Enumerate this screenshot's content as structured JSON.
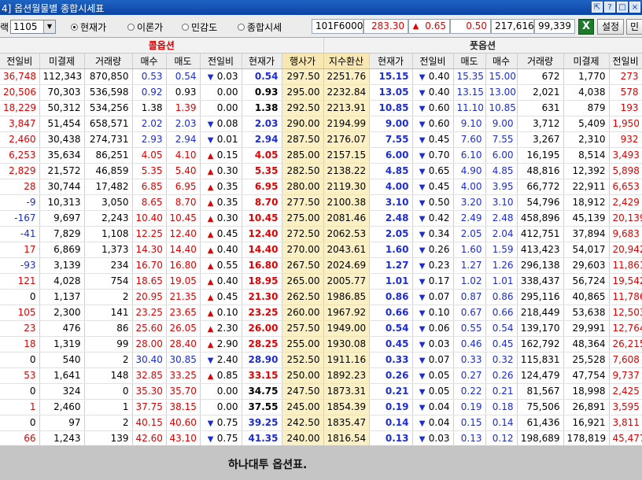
{
  "window": {
    "title": "4] 옵션월물별 종합시세표",
    "buttons": [
      "⇱",
      "?",
      "□",
      "×"
    ]
  },
  "toolbar": {
    "month_label": "랙",
    "month_value": "1105",
    "radios": [
      {
        "label": "현재가",
        "checked": true
      },
      {
        "label": "이론가",
        "checked": false
      },
      {
        "label": "민감도",
        "checked": false
      },
      {
        "label": "종합시세",
        "checked": false
      }
    ],
    "future_code": "101F6000",
    "future_price": "283.30",
    "future_change_sign": "▲",
    "future_change": "0.65",
    "future_change_pct": "0.50",
    "future_volume": "217,616",
    "future_oi": "99,339",
    "excel_icon": "X",
    "settings_label": "설정",
    "extra_label": "민"
  },
  "groups": {
    "call": "콜옵션",
    "put": "풋옵션"
  },
  "headers": [
    "전일비",
    "미결제",
    "거래량",
    "매수",
    "매도",
    "전일비",
    "현재가",
    "행사가",
    "지수환산",
    "현재가",
    "전일비",
    "매도",
    "매수",
    "거래량",
    "미결제",
    "전일비"
  ],
  "rows": [
    {
      "c": [
        "36,748",
        "112,343",
        "870,850",
        "0.53",
        "0.54",
        "down",
        "0.03",
        "0.54",
        "297.50",
        "2251.76",
        "15.15",
        "down",
        "0.40",
        "15.35",
        "15.00",
        "672",
        "1,770",
        "273"
      ],
      "col": [
        "red",
        "black",
        "black",
        "blue",
        "blue",
        "blue",
        "black",
        "blue",
        "black",
        "black",
        "blue",
        "blue",
        "black",
        "blue",
        "blue",
        "black",
        "black",
        "red"
      ]
    },
    {
      "c": [
        "20,506",
        "70,303",
        "536,598",
        "0.92",
        "0.93",
        "flat",
        "0.00",
        "0.93",
        "295.00",
        "2232.84",
        "13.05",
        "down",
        "0.40",
        "13.15",
        "13.00",
        "2,021",
        "4,038",
        "578"
      ],
      "col": [
        "red",
        "black",
        "black",
        "blue",
        "black",
        "black",
        "black",
        "black",
        "black",
        "black",
        "blue",
        "blue",
        "black",
        "blue",
        "blue",
        "black",
        "black",
        "red"
      ]
    },
    {
      "c": [
        "18,229",
        "50,312",
        "534,256",
        "1.38",
        "1.39",
        "flat",
        "0.00",
        "1.38",
        "292.50",
        "2213.91",
        "10.85",
        "down",
        "0.60",
        "11.10",
        "10.85",
        "631",
        "879",
        "193"
      ],
      "col": [
        "red",
        "black",
        "black",
        "black",
        "red",
        "black",
        "black",
        "black",
        "black",
        "black",
        "blue",
        "blue",
        "black",
        "blue",
        "blue",
        "black",
        "black",
        "red"
      ]
    },
    {
      "c": [
        "3,847",
        "51,454",
        "658,571",
        "2.02",
        "2.03",
        "down",
        "0.08",
        "2.03",
        "290.00",
        "2194.99",
        "9.00",
        "down",
        "0.60",
        "9.10",
        "9.00",
        "3,712",
        "5,409",
        "1,950"
      ],
      "col": [
        "red",
        "black",
        "black",
        "blue",
        "blue",
        "blue",
        "black",
        "blue",
        "black",
        "black",
        "blue",
        "blue",
        "black",
        "blue",
        "blue",
        "black",
        "black",
        "red"
      ]
    },
    {
      "c": [
        "2,460",
        "30,438",
        "274,731",
        "2.93",
        "2.94",
        "down",
        "0.01",
        "2.94",
        "287.50",
        "2176.07",
        "7.55",
        "down",
        "0.45",
        "7.60",
        "7.55",
        "3,267",
        "2,310",
        "932"
      ],
      "col": [
        "red",
        "black",
        "black",
        "blue",
        "blue",
        "blue",
        "black",
        "blue",
        "black",
        "black",
        "blue",
        "blue",
        "black",
        "blue",
        "blue",
        "black",
        "black",
        "red"
      ]
    },
    {
      "c": [
        "6,253",
        "35,634",
        "86,251",
        "4.05",
        "4.10",
        "up",
        "0.15",
        "4.05",
        "285.00",
        "2157.15",
        "6.00",
        "down",
        "0.70",
        "6.10",
        "6.00",
        "16,195",
        "8,514",
        "3,493"
      ],
      "col": [
        "red",
        "black",
        "black",
        "red",
        "red",
        "red",
        "black",
        "red",
        "black",
        "black",
        "blue",
        "blue",
        "black",
        "blue",
        "blue",
        "black",
        "black",
        "red"
      ]
    },
    {
      "c": [
        "2,829",
        "21,572",
        "46,859",
        "5.35",
        "5.40",
        "up",
        "0.30",
        "5.35",
        "282.50",
        "2138.22",
        "4.85",
        "down",
        "0.65",
        "4.90",
        "4.85",
        "48,816",
        "12,392",
        "5,898"
      ],
      "col": [
        "red",
        "black",
        "black",
        "red",
        "red",
        "red",
        "black",
        "red",
        "black",
        "black",
        "blue",
        "blue",
        "black",
        "blue",
        "blue",
        "black",
        "black",
        "red"
      ]
    },
    {
      "c": [
        "28",
        "30,744",
        "17,482",
        "6.85",
        "6.95",
        "up",
        "0.35",
        "6.95",
        "280.00",
        "2119.30",
        "4.00",
        "down",
        "0.45",
        "4.00",
        "3.95",
        "66,772",
        "22,911",
        "6,653"
      ],
      "col": [
        "red",
        "black",
        "black",
        "red",
        "red",
        "red",
        "black",
        "red",
        "black",
        "black",
        "blue",
        "blue",
        "black",
        "blue",
        "blue",
        "black",
        "black",
        "red"
      ]
    },
    {
      "c": [
        "-9",
        "10,313",
        "3,050",
        "8.65",
        "8.70",
        "up",
        "0.35",
        "8.70",
        "277.50",
        "2100.38",
        "3.10",
        "down",
        "0.50",
        "3.20",
        "3.10",
        "54,796",
        "18,912",
        "2,429"
      ],
      "col": [
        "blue",
        "black",
        "black",
        "red",
        "red",
        "red",
        "black",
        "red",
        "black",
        "black",
        "blue",
        "blue",
        "black",
        "blue",
        "blue",
        "black",
        "black",
        "red"
      ]
    },
    {
      "c": [
        "-167",
        "9,697",
        "2,243",
        "10.40",
        "10.45",
        "up",
        "0.30",
        "10.45",
        "275.00",
        "2081.46",
        "2.48",
        "down",
        "0.42",
        "2.49",
        "2.48",
        "458,896",
        "45,139",
        "20,139"
      ],
      "col": [
        "blue",
        "black",
        "black",
        "red",
        "red",
        "red",
        "black",
        "red",
        "black",
        "black",
        "blue",
        "blue",
        "black",
        "blue",
        "blue",
        "black",
        "black",
        "red"
      ]
    },
    {
      "c": [
        "-41",
        "7,829",
        "1,108",
        "12.25",
        "12.40",
        "up",
        "0.45",
        "12.40",
        "272.50",
        "2062.53",
        "2.05",
        "down",
        "0.34",
        "2.05",
        "2.04",
        "412,751",
        "37,894",
        "9,683"
      ],
      "col": [
        "blue",
        "black",
        "black",
        "red",
        "red",
        "red",
        "black",
        "red",
        "black",
        "black",
        "blue",
        "blue",
        "black",
        "blue",
        "blue",
        "black",
        "black",
        "red"
      ]
    },
    {
      "c": [
        "17",
        "6,869",
        "1,373",
        "14.30",
        "14.40",
        "up",
        "0.40",
        "14.40",
        "270.00",
        "2043.61",
        "1.60",
        "down",
        "0.26",
        "1.60",
        "1.59",
        "413,423",
        "54,017",
        "20,942"
      ],
      "col": [
        "red",
        "black",
        "black",
        "red",
        "red",
        "red",
        "black",
        "red",
        "black",
        "black",
        "blue",
        "blue",
        "black",
        "blue",
        "blue",
        "black",
        "black",
        "red"
      ]
    },
    {
      "c": [
        "-93",
        "3,139",
        "234",
        "16.70",
        "16.80",
        "up",
        "0.55",
        "16.80",
        "267.50",
        "2024.69",
        "1.27",
        "down",
        "0.23",
        "1.27",
        "1.26",
        "296,138",
        "29,603",
        "11,861"
      ],
      "col": [
        "blue",
        "black",
        "black",
        "red",
        "red",
        "red",
        "black",
        "red",
        "black",
        "black",
        "blue",
        "blue",
        "black",
        "blue",
        "blue",
        "black",
        "black",
        "red"
      ]
    },
    {
      "c": [
        "121",
        "4,028",
        "754",
        "18.65",
        "19.05",
        "up",
        "0.40",
        "18.95",
        "265.00",
        "2005.77",
        "1.01",
        "down",
        "0.17",
        "1.02",
        "1.01",
        "338,437",
        "56,724",
        "19,542"
      ],
      "col": [
        "red",
        "black",
        "black",
        "red",
        "red",
        "red",
        "black",
        "red",
        "black",
        "black",
        "blue",
        "blue",
        "black",
        "blue",
        "blue",
        "black",
        "black",
        "red"
      ]
    },
    {
      "c": [
        "0",
        "1,137",
        "2",
        "20.95",
        "21.35",
        "up",
        "0.45",
        "21.30",
        "262.50",
        "1986.85",
        "0.86",
        "down",
        "0.07",
        "0.87",
        "0.86",
        "295,116",
        "40,865",
        "11,786"
      ],
      "col": [
        "black",
        "black",
        "black",
        "red",
        "red",
        "red",
        "black",
        "red",
        "black",
        "black",
        "blue",
        "blue",
        "black",
        "blue",
        "blue",
        "black",
        "black",
        "red"
      ]
    },
    {
      "c": [
        "105",
        "2,300",
        "141",
        "23.25",
        "23.65",
        "up",
        "0.10",
        "23.25",
        "260.00",
        "1967.92",
        "0.66",
        "down",
        "0.10",
        "0.67",
        "0.66",
        "218,449",
        "53,638",
        "12,503"
      ],
      "col": [
        "red",
        "black",
        "black",
        "red",
        "red",
        "red",
        "black",
        "red",
        "black",
        "black",
        "blue",
        "blue",
        "black",
        "blue",
        "blue",
        "black",
        "black",
        "red"
      ]
    },
    {
      "c": [
        "23",
        "476",
        "86",
        "25.60",
        "26.05",
        "up",
        "2.30",
        "26.00",
        "257.50",
        "1949.00",
        "0.54",
        "down",
        "0.06",
        "0.55",
        "0.54",
        "139,170",
        "29,991",
        "12,764"
      ],
      "col": [
        "red",
        "black",
        "black",
        "red",
        "red",
        "red",
        "black",
        "red",
        "black",
        "black",
        "blue",
        "blue",
        "black",
        "blue",
        "blue",
        "black",
        "black",
        "red"
      ]
    },
    {
      "c": [
        "18",
        "1,319",
        "99",
        "28.00",
        "28.40",
        "up",
        "2.90",
        "28.25",
        "255.00",
        "1930.08",
        "0.45",
        "down",
        "0.03",
        "0.46",
        "0.45",
        "162,792",
        "48,364",
        "26,215"
      ],
      "col": [
        "red",
        "black",
        "black",
        "red",
        "red",
        "red",
        "black",
        "red",
        "black",
        "black",
        "blue",
        "blue",
        "black",
        "blue",
        "blue",
        "black",
        "black",
        "red"
      ]
    },
    {
      "c": [
        "0",
        "540",
        "2",
        "30.40",
        "30.85",
        "down",
        "2.40",
        "28.90",
        "252.50",
        "1911.16",
        "0.33",
        "down",
        "0.07",
        "0.33",
        "0.32",
        "115,831",
        "25,528",
        "7,608"
      ],
      "col": [
        "black",
        "black",
        "black",
        "blue",
        "blue",
        "blue",
        "black",
        "blue",
        "black",
        "black",
        "blue",
        "blue",
        "black",
        "blue",
        "blue",
        "black",
        "black",
        "red"
      ]
    },
    {
      "c": [
        "53",
        "1,641",
        "148",
        "32.85",
        "33.25",
        "up",
        "0.85",
        "33.15",
        "250.00",
        "1892.23",
        "0.26",
        "down",
        "0.05",
        "0.27",
        "0.26",
        "124,479",
        "47,754",
        "9,737"
      ],
      "col": [
        "red",
        "black",
        "black",
        "red",
        "red",
        "red",
        "black",
        "red",
        "black",
        "black",
        "blue",
        "blue",
        "black",
        "blue",
        "blue",
        "black",
        "black",
        "red"
      ]
    },
    {
      "c": [
        "0",
        "324",
        "0",
        "35.30",
        "35.70",
        "flat",
        "0.00",
        "34.75",
        "247.50",
        "1873.31",
        "0.21",
        "down",
        "0.05",
        "0.22",
        "0.21",
        "81,567",
        "18,998",
        "2,425"
      ],
      "col": [
        "black",
        "black",
        "black",
        "red",
        "red",
        "black",
        "black",
        "black",
        "black",
        "black",
        "blue",
        "blue",
        "black",
        "blue",
        "blue",
        "black",
        "black",
        "red"
      ]
    },
    {
      "c": [
        "1",
        "2,460",
        "1",
        "37.75",
        "38.15",
        "flat",
        "0.00",
        "37.55",
        "245.00",
        "1854.39",
        "0.19",
        "down",
        "0.04",
        "0.19",
        "0.18",
        "75,506",
        "26,891",
        "3,595"
      ],
      "col": [
        "red",
        "black",
        "black",
        "red",
        "red",
        "black",
        "black",
        "black",
        "black",
        "black",
        "blue",
        "blue",
        "black",
        "blue",
        "blue",
        "black",
        "black",
        "red"
      ]
    },
    {
      "c": [
        "0",
        "97",
        "2",
        "40.15",
        "40.60",
        "down",
        "0.75",
        "39.25",
        "242.50",
        "1835.47",
        "0.14",
        "down",
        "0.04",
        "0.15",
        "0.14",
        "61,436",
        "16,921",
        "3,811"
      ],
      "col": [
        "black",
        "black",
        "black",
        "red",
        "red",
        "blue",
        "black",
        "blue",
        "black",
        "black",
        "blue",
        "blue",
        "black",
        "blue",
        "blue",
        "black",
        "black",
        "red"
      ]
    },
    {
      "c": [
        "66",
        "1,243",
        "139",
        "42.60",
        "43.10",
        "down",
        "0.75",
        "41.35",
        "240.00",
        "1816.54",
        "0.13",
        "down",
        "0.03",
        "0.13",
        "0.12",
        "198,689",
        "178,819",
        "45,477"
      ],
      "col": [
        "red",
        "black",
        "black",
        "red",
        "red",
        "blue",
        "black",
        "blue",
        "black",
        "black",
        "blue",
        "blue",
        "black",
        "blue",
        "blue",
        "black",
        "black",
        "red"
      ]
    }
  ],
  "footer": {
    "caption": "하나대투 옵션표."
  }
}
